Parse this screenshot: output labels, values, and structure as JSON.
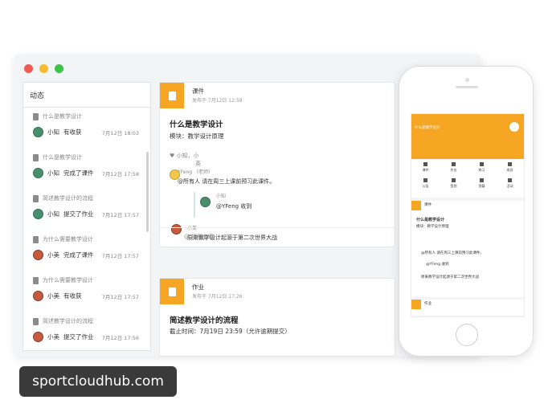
{
  "sidebar": {
    "header": "动态",
    "items": [
      {
        "course": "什么是教学设计",
        "user": "小知",
        "action": "有收获",
        "time": "7月12日 18:03",
        "avatar": "green"
      },
      {
        "course": "什么是教学设计",
        "user": "小知",
        "action": "完成了课件",
        "time": "7月12日 17:58",
        "avatar": "green"
      },
      {
        "course": "简述教学设计的流程",
        "user": "小知",
        "action": "提交了作业",
        "time": "7月12日 17:57",
        "avatar": "green"
      },
      {
        "course": "为什么需要教学设计",
        "user": "小美",
        "action": "完成了课件",
        "time": "7月12日 17:57",
        "avatar": "red"
      },
      {
        "course": "为什么需要教学设计",
        "user": "小美",
        "action": "有收获",
        "time": "7月12日 17:57",
        "avatar": "red"
      },
      {
        "course": "简述教学设计的流程",
        "user": "小美",
        "action": "提交了作业",
        "time": "7月12日 17:56",
        "avatar": "red"
      }
    ]
  },
  "card1": {
    "type": "课件",
    "meta": "发布于 7月12日 12:58",
    "title": "什么是教学设计",
    "module": "模块：教学设计原理",
    "likes": "♥ 小知，小",
    "likes2": "英",
    "c1_name": "YFeng （老师）",
    "c1_text": "@所有人 请在周三上课前预习此课件。",
    "reply_name": "小知",
    "reply_text": "@YFeng 收到",
    "c2_name": "小美",
    "c2_text": "原来教学设计起源于第二次世界大战",
    "remind": "@ 提醒查看"
  },
  "card2": {
    "type": "作业",
    "meta": "发布于 7月12日 17:26",
    "title": "简述教学设计的流程",
    "deadline": "截止时间：7月19日 23:59（允许逾期提交）"
  },
  "phone": {
    "header_title": "什么是教学设计",
    "grid": [
      "课件",
      "作业",
      "练习",
      "成员",
      "公告",
      "签到",
      "答疑",
      "活动"
    ],
    "card_type": "课件",
    "card_title": "什么是教学设计",
    "card_module": "模块：教学设计原理",
    "card_comment1": "@所有人 请在周三上课前预习此课件。",
    "card_reply": "@YFeng 收到",
    "card_comment2": "原来教学设计起源于第二次世界大战",
    "card2_type": "作业"
  },
  "watermark": "sportcloudhub.com",
  "colors": {
    "accent": "#f6a623",
    "red": "#f25a55",
    "yellow": "#f7bc2f",
    "green": "#3ec34a"
  }
}
